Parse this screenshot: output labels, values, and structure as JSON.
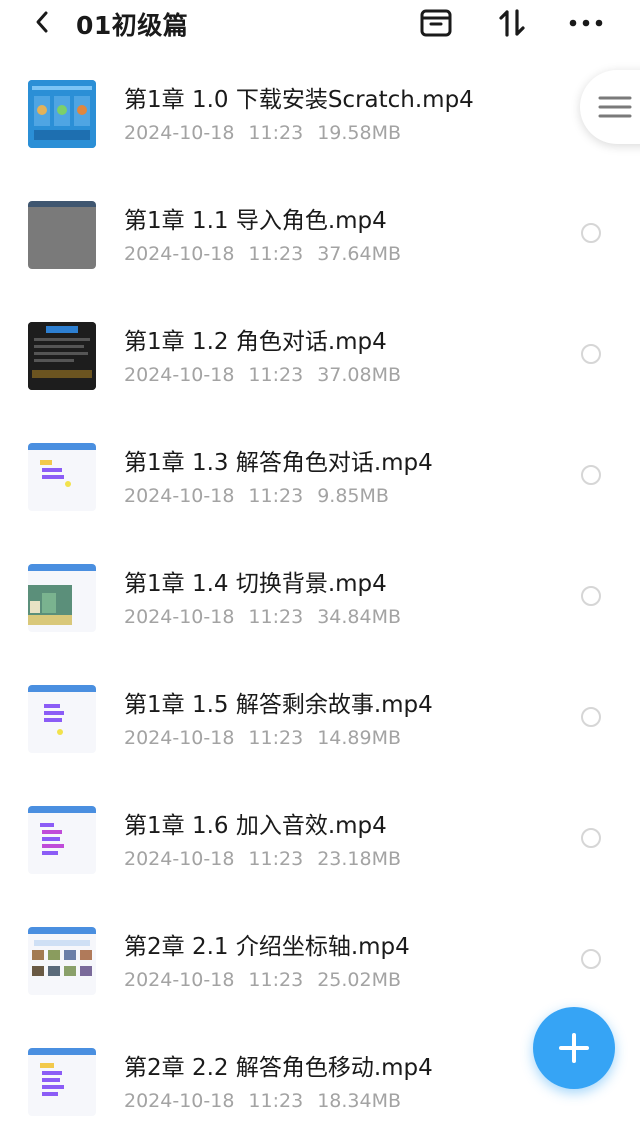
{
  "header": {
    "title": "01初级篇"
  },
  "files": [
    {
      "name": "第1章 1.0 下载安装Scratch.mp4",
      "date": "2024-10-18",
      "time": "11:23",
      "size": "19.58MB",
      "thumb": "blue"
    },
    {
      "name": "第1章 1.1 导入角色.mp4",
      "date": "2024-10-18",
      "time": "11:23",
      "size": "37.64MB",
      "thumb": "gray"
    },
    {
      "name": "第1章 1.2 角色对话.mp4",
      "date": "2024-10-18",
      "time": "11:23",
      "size": "37.08MB",
      "thumb": "dark"
    },
    {
      "name": "第1章 1.3 解答角色对话.mp4",
      "date": "2024-10-18",
      "time": "11:23",
      "size": "9.85MB",
      "thumb": "app"
    },
    {
      "name": "第1章 1.4 切换背景.mp4",
      "date": "2024-10-18",
      "time": "11:23",
      "size": "34.84MB",
      "thumb": "app-scene"
    },
    {
      "name": "第1章 1.5 解答剩余故事.mp4",
      "date": "2024-10-18",
      "time": "11:23",
      "size": "14.89MB",
      "thumb": "app"
    },
    {
      "name": "第1章 1.6 加入音效.mp4",
      "date": "2024-10-18",
      "time": "11:23",
      "size": "23.18MB",
      "thumb": "app"
    },
    {
      "name": "第2章 2.1 介绍坐标轴.mp4",
      "date": "2024-10-18",
      "time": "11:23",
      "size": "25.02MB",
      "thumb": "app-grid"
    },
    {
      "name": "第2章 2.2 解答角色移动.mp4",
      "date": "2024-10-18",
      "time": "11:23",
      "size": "18.34MB",
      "thumb": "app"
    }
  ],
  "colors": {
    "accent": "#36a4f5",
    "meta_text": "#a3a3a3",
    "title_text": "#1a1a1a"
  },
  "icons": {
    "back": "chevron-left-icon",
    "archive": "archive-box-icon",
    "sort": "sort-arrows-icon",
    "more": "more-dots-icon",
    "side": "menu-lines-icon",
    "fab": "plus-icon"
  }
}
